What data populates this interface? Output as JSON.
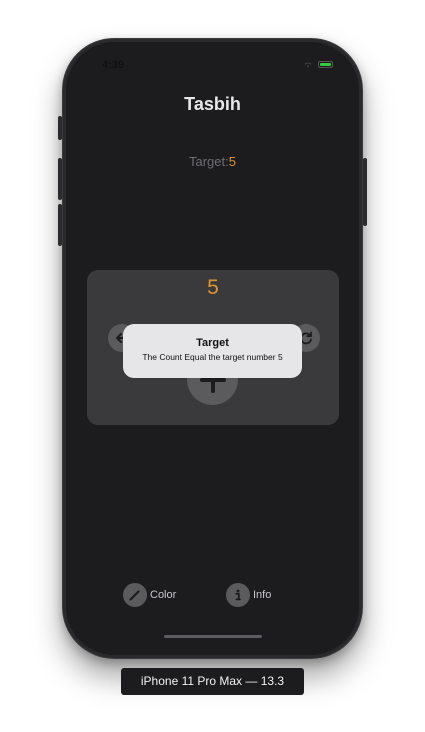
{
  "status_bar": {
    "time": "4:39"
  },
  "app": {
    "title": "Tasbih",
    "target_label": "Target:",
    "target_value": "5",
    "count": "5"
  },
  "card": {
    "left_icon": "back-arrow-icon",
    "right_icon": "refresh-icon",
    "center_icon": "plus-icon"
  },
  "alert": {
    "title": "Target",
    "message": "The Count Equal the target number 5"
  },
  "bottom_bar": {
    "color_label": "Color",
    "color_icon": "pencil-icon",
    "info_label": "Info",
    "info_icon": "info-icon"
  },
  "device_label": "iPhone 11 Pro Max — 13.3",
  "colors": {
    "accent": "#e0932e",
    "screen_bg": "#1c1c1e",
    "card_bg": "#3a3a3c"
  }
}
